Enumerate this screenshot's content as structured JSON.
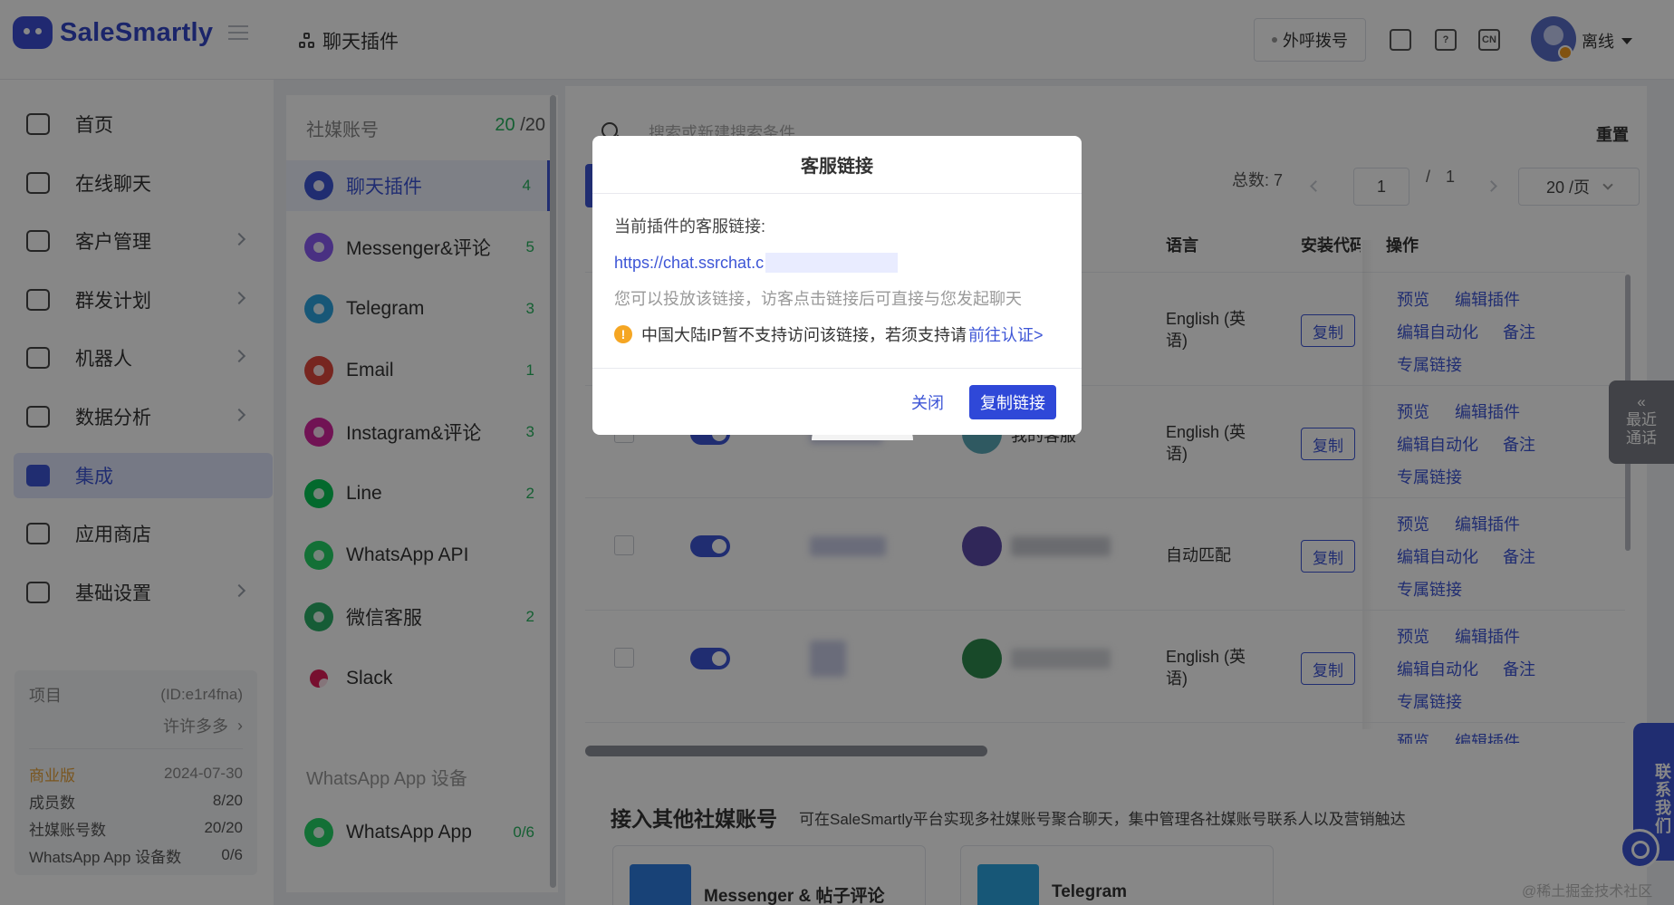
{
  "app": {
    "brand": "SaleSmartly",
    "page_title": "聊天插件",
    "dial_label": "外呼拨号",
    "lang_icon_text": "CN",
    "user_status": "离线"
  },
  "nav": {
    "items": [
      {
        "label": "首页",
        "icon": "home-icon",
        "has_arrow": false
      },
      {
        "label": "在线聊天",
        "icon": "chat-icon",
        "has_arrow": false
      },
      {
        "label": "客户管理",
        "icon": "users-icon",
        "has_arrow": true
      },
      {
        "label": "群发计划",
        "icon": "send-icon",
        "has_arrow": true
      },
      {
        "label": "机器人",
        "icon": "robot-icon",
        "has_arrow": true
      },
      {
        "label": "数据分析",
        "icon": "chart-icon",
        "has_arrow": true
      },
      {
        "label": "集成",
        "icon": "integration-icon",
        "has_arrow": false,
        "active": true
      },
      {
        "label": "应用商店",
        "icon": "app-store-icon",
        "has_arrow": false
      },
      {
        "label": "基础设置",
        "icon": "settings-icon",
        "has_arrow": true
      }
    ]
  },
  "project": {
    "label": "项目",
    "id": "(ID:e1r4fna)",
    "name": "许许多多",
    "plan": "商业版",
    "expire": "2024-07-30",
    "stats": [
      {
        "label": "成员数",
        "value": "8/20"
      },
      {
        "label": "社媒账号数",
        "value": "20/20"
      },
      {
        "label": "WhatsApp App 设备数",
        "value": "0/6"
      }
    ]
  },
  "accounts": {
    "header": "社媒账号",
    "count_used": "20",
    "count_total": " /20",
    "items": [
      {
        "label": "聊天插件",
        "count": "4",
        "color": "#3d55d6",
        "active": true
      },
      {
        "label": "Messenger&评论",
        "count": "5",
        "color": "#8b5cf6"
      },
      {
        "label": "Telegram",
        "count": "3",
        "color": "#2ca5e0"
      },
      {
        "label": "Email",
        "count": "1",
        "color": "#e0483e"
      },
      {
        "label": "Instagram&评论",
        "count": "3",
        "color": "#d6249f"
      },
      {
        "label": "Line",
        "count": "2",
        "color": "#06c755"
      },
      {
        "label": "WhatsApp API",
        "count": "",
        "color": "#25d366"
      },
      {
        "label": "微信客服",
        "count": "2",
        "color": "#2aae67"
      },
      {
        "label": "Slack",
        "count": "",
        "color": "#e01e5a"
      }
    ],
    "sub_header": "WhatsApp App 设备",
    "sub_items": [
      {
        "label": "WhatsApp App",
        "count": "0/6",
        "color": "#25d366"
      }
    ]
  },
  "table": {
    "search_placeholder": "搜索或新建搜索条件",
    "reset": "重置",
    "total_label": "总数:",
    "total": "7",
    "page_current": "1",
    "page_sep": "/",
    "page_total": "1",
    "page_size": "20 /页",
    "headers": {
      "lang": "语言",
      "install": "安装代码",
      "ops": "操作"
    },
    "rows": [
      {
        "lang": "English (英\n语)",
        "bot_name": "",
        "copy": "复制"
      },
      {
        "lang": "English (英\n语)",
        "bot_name": "我的客服",
        "copy": "复制"
      },
      {
        "lang": "自动匹配",
        "bot_name": "",
        "copy": "复制"
      },
      {
        "lang": "English (英\n语)",
        "bot_name": "",
        "copy": "复制"
      }
    ],
    "ops": {
      "preview": "预览",
      "edit_plugin": "编辑插件",
      "edit_auto": "编辑自动化",
      "note": "备注",
      "exclusive": "专属链接"
    }
  },
  "other": {
    "title": "接入其他社媒账号",
    "desc": "可在SaleSmartly平台实现多社媒账号聚合聊天，集中管理各社媒账号联系人以及营销触达",
    "cards": [
      {
        "label": "Messenger & 帖子评论",
        "color": "#2f7de1"
      },
      {
        "label": "Telegram",
        "color": "#2ca5e0"
      }
    ]
  },
  "side": {
    "recent_line1": "最近",
    "recent_line2": "通话",
    "contact": "联系我们",
    "watermark": "@稀土掘金技术社区"
  },
  "modal": {
    "title": "客服链接",
    "label": "当前插件的客服链接:",
    "link": "https://chat.ssrchat.c",
    "hint": "您可以投放该链接，访客点击链接后可直接与您发起聊天",
    "warning": "中国大陆IP暂不支持访问该链接，若须支持请",
    "goto": "前往认证>",
    "close": "关闭",
    "copy": "复制链接"
  }
}
